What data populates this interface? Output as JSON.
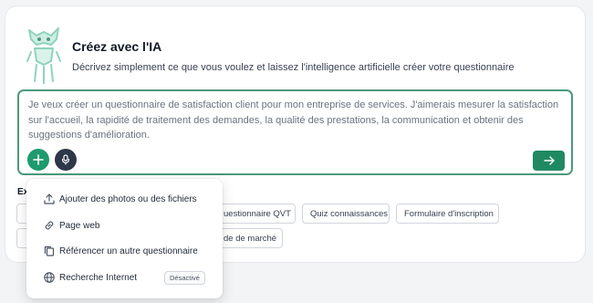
{
  "header": {
    "title": "Créez avec l'IA",
    "subtitle": "Décrivez simplement ce que vous voulez et laissez l'intelligence artificielle créer votre questionnaire"
  },
  "prompt": {
    "value": "Je veux créer un questionnaire de satisfaction client pour mon entreprise de services. J'aimerais mesurer la satisfaction sur l'accueil, la rapidité de traitement des demandes, la qualité des prestations, la communication et obtenir des suggestions d'amélioration."
  },
  "examples": {
    "label_visible": "Ex",
    "chips": [
      "uestionnaire QVT",
      "Quiz connaissances",
      "Formulaire d'inscription",
      "de de marché"
    ]
  },
  "menu": {
    "items": [
      {
        "label": "Ajouter des photos ou des fichiers",
        "icon": "upload-icon"
      },
      {
        "label": "Page web",
        "icon": "link-icon"
      },
      {
        "label": "Référencer un autre questionnaire",
        "icon": "copy-icon"
      },
      {
        "label": "Recherche Internet",
        "icon": "globe-icon",
        "badge": "Désactivé"
      }
    ]
  },
  "colors": {
    "accent": "#1f9a6e",
    "border_accent": "#4a9a7c",
    "mic": "#2d3748",
    "mascot": "#a7e0cf"
  }
}
